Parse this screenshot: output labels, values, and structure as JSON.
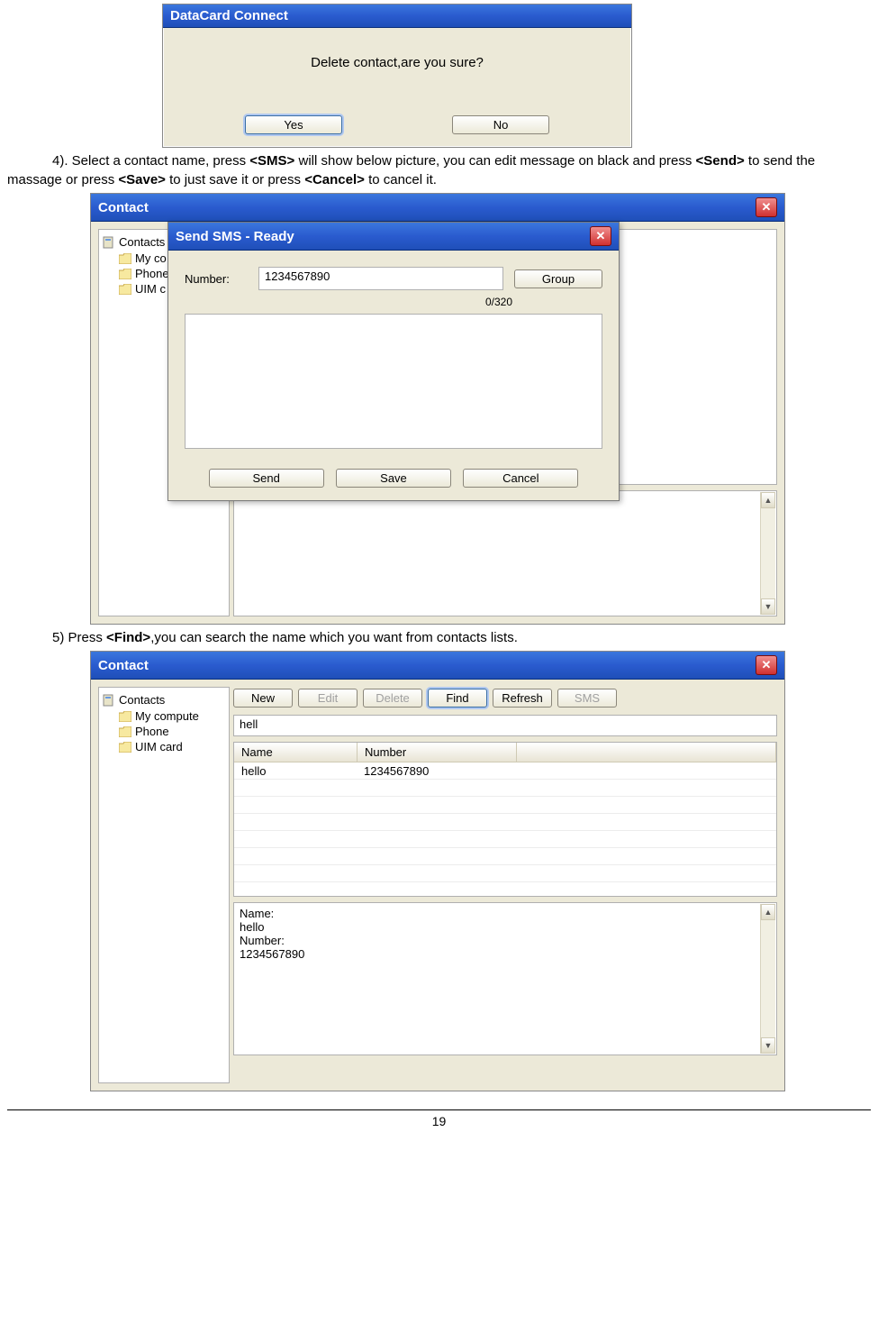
{
  "confirm": {
    "title": "DataCard Connect",
    "message": "Delete contact,are you sure?",
    "yes": "Yes",
    "no": "No"
  },
  "doc": {
    "line4_pre": "4). Select a contact name, press ",
    "line4_b1": "<SMS>",
    "line4_mid1": " will show below picture, you can edit message on black and press ",
    "line4_b2": "<Send>",
    "line4_mid2": " to send the massage or press ",
    "line4_b3": "<Save>",
    "line4_mid3": " to just save it or press ",
    "line4_b4": "<Cancel>",
    "line4_end": " to cancel it.",
    "line5_pre": "5) Press ",
    "line5_b1": "<Find>",
    "line5_end": ",you can search the name which you want from contacts lists.",
    "page_number": "19"
  },
  "contact": {
    "title": "Contact",
    "tree_root": "Contacts",
    "tree_items": [
      "My compute",
      "Phone",
      "UIM card"
    ],
    "tree_items_short": [
      "My co",
      "Phone",
      "UIM c"
    ]
  },
  "sms": {
    "title": "Send SMS - Ready",
    "number_label": "Number:",
    "number_value": "1234567890",
    "group_btn": "Group",
    "counter": "0/320",
    "send": "Send",
    "save": "Save",
    "cancel": "Cancel"
  },
  "toolbar2": {
    "new": "New",
    "edit": "Edit",
    "delete": "Delete",
    "find": "Find",
    "refresh": "Refresh",
    "sms": "SMS"
  },
  "search2": {
    "value": "hell"
  },
  "grid2": {
    "col_name": "Name",
    "col_number": "Number",
    "row1_name": "hello",
    "row1_number": "1234567890"
  },
  "details2": {
    "l1": "Name:",
    "l2": "hello",
    "l3": "Number:",
    "l4": "1234567890"
  }
}
